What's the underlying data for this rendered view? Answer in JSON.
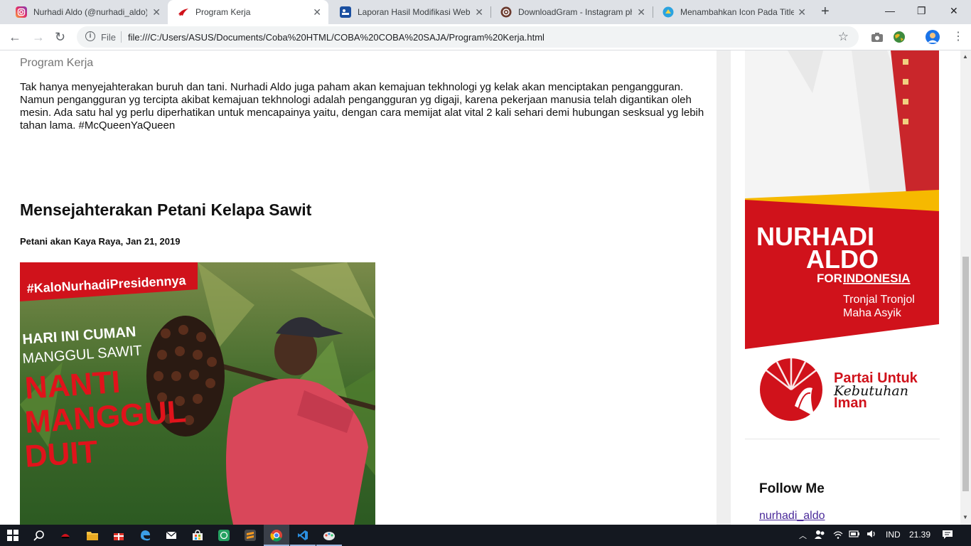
{
  "browser": {
    "tabs": [
      {
        "title": "Nurhadi Aldo (@nurhadi_aldo)",
        "icon": "instagram-icon",
        "active": false
      },
      {
        "title": "Program Kerja",
        "icon": "nurhadi-logo-icon",
        "active": true
      },
      {
        "title": "Laporan Hasil Modifikasi Web",
        "icon": "report-icon",
        "active": false
      },
      {
        "title": "DownloadGram - Instagram photo",
        "icon": "downloadgram-icon",
        "active": false
      },
      {
        "title": "Menambahkan Icon Pada Title",
        "icon": "blog-icon",
        "active": false
      }
    ],
    "close_glyph": "✕",
    "new_tab_glyph": "+",
    "window_controls": {
      "minimize": "—",
      "restore": "❐",
      "close": "✕"
    },
    "nav": {
      "back": "←",
      "forward": "→",
      "reload": "↻"
    },
    "omnibox": {
      "scheme_label": "File",
      "url": "file:///C:/Users/ASUS/Documents/Coba%20HTML/COBA%20COBA%20SAJA/Program%20Kerja.html"
    }
  },
  "page": {
    "breadcrumb": "Program Kerja",
    "intro_paragraph": "Tak hanya menyejahterakan buruh dan tani. Nurhadi Aldo juga paham akan kemajuan tekhnologi yg kelak akan menciptakan pengangguran. Namun pengangguran yg tercipta akibat kemajuan tekhnologi adalah pengangguran yg digaji, karena pekerjaan manusia telah digantikan oleh mesin. Ada satu hal yg perlu diperhatikan untuk mencapainya yaitu, dengan cara memijat alat vital 2 kali sehari demi hubungan sesksual yg lebih tahan lama. #McQueenYaQueen",
    "post": {
      "title": "Mensejahterakan Petani Kelapa Sawit",
      "meta": "Petani akan Kaya Raya, Jan 21, 2019",
      "image": {
        "hashtag": "#KaloNurhadiPresidennya",
        "line1": "HARI INI CUMAN",
        "line2": "MANGGUL SAWIT",
        "line3": "NANTI",
        "line4": "MANGGUL",
        "line5": "DUIT"
      }
    }
  },
  "sidebar": {
    "poster": {
      "name_line1": "NURHADI",
      "name_line2": "ALDO",
      "for_word": "FOR",
      "country_word": "INDONESIA",
      "tagline1": "Tronjal Tronjol",
      "tagline2": "Maha Asyik"
    },
    "party_logo": {
      "line1": "Partai Untuk",
      "script": "Kebutuhan",
      "line3": "Iman"
    },
    "follow_heading": "Follow Me",
    "follow_link": "nurhadi_aldo"
  },
  "taskbar": {
    "apps": [
      "start-icon",
      "search-icon",
      "app-icon",
      "file-explorer-icon",
      "gift-app-icon",
      "edge-icon",
      "mail-icon",
      "store-icon",
      "whatsapp-icon",
      "sublime-icon",
      "chrome-icon",
      "vscode-icon",
      "paint-icon"
    ],
    "language": "IND",
    "time": "21.39"
  },
  "colors": {
    "brand_red": "#d0121b",
    "brand_yellow": "#f6b900",
    "link": "#4a2a9a"
  }
}
